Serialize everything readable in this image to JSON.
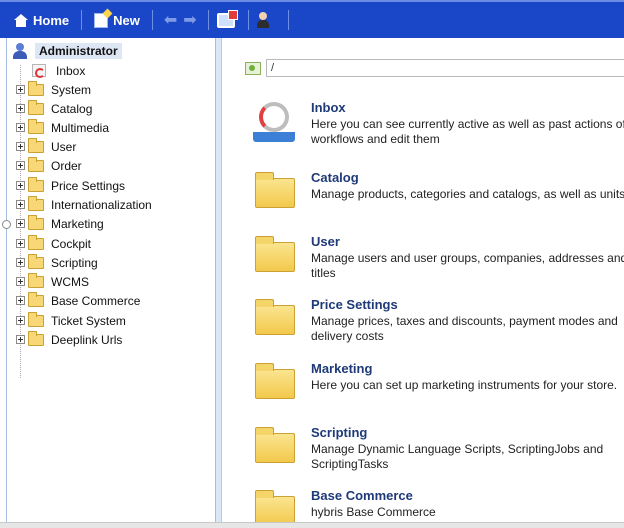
{
  "toolbar": {
    "home_label": "Home",
    "new_label": "New"
  },
  "sidebar": {
    "root_label": "Administrator",
    "inbox_label": "Inbox",
    "items": [
      {
        "label": "System"
      },
      {
        "label": "Catalog"
      },
      {
        "label": "Multimedia"
      },
      {
        "label": "User"
      },
      {
        "label": "Order"
      },
      {
        "label": "Price Settings"
      },
      {
        "label": "Internationalization"
      },
      {
        "label": "Marketing"
      },
      {
        "label": "Cockpit"
      },
      {
        "label": "Scripting"
      },
      {
        "label": "WCMS"
      },
      {
        "label": "Base Commerce"
      },
      {
        "label": "Ticket System"
      },
      {
        "label": "Deeplink Urls"
      }
    ]
  },
  "main": {
    "path_value": "/",
    "entries": [
      {
        "icon": "inbox",
        "title": "Inbox",
        "desc": "Here you can see currently active as well as past actions of workflows and edit them"
      },
      {
        "icon": "folder",
        "title": "Catalog",
        "desc": "Manage products, categories and catalogs, as well as units"
      },
      {
        "icon": "folder",
        "title": "User",
        "desc": "Manage users and user groups, companies, addresses and titles"
      },
      {
        "icon": "folder",
        "title": "Price Settings",
        "desc": "Manage prices, taxes and discounts, payment modes and delivery costs"
      },
      {
        "icon": "folder",
        "title": "Marketing",
        "desc": "Here you can set up marketing instruments for your store."
      },
      {
        "icon": "folder",
        "title": "Scripting",
        "desc": "Manage Dynamic Language Scripts, ScriptingJobs and ScriptingTasks"
      },
      {
        "icon": "folder",
        "title": "Base Commerce",
        "desc": "hybris Base Commerce"
      }
    ]
  }
}
